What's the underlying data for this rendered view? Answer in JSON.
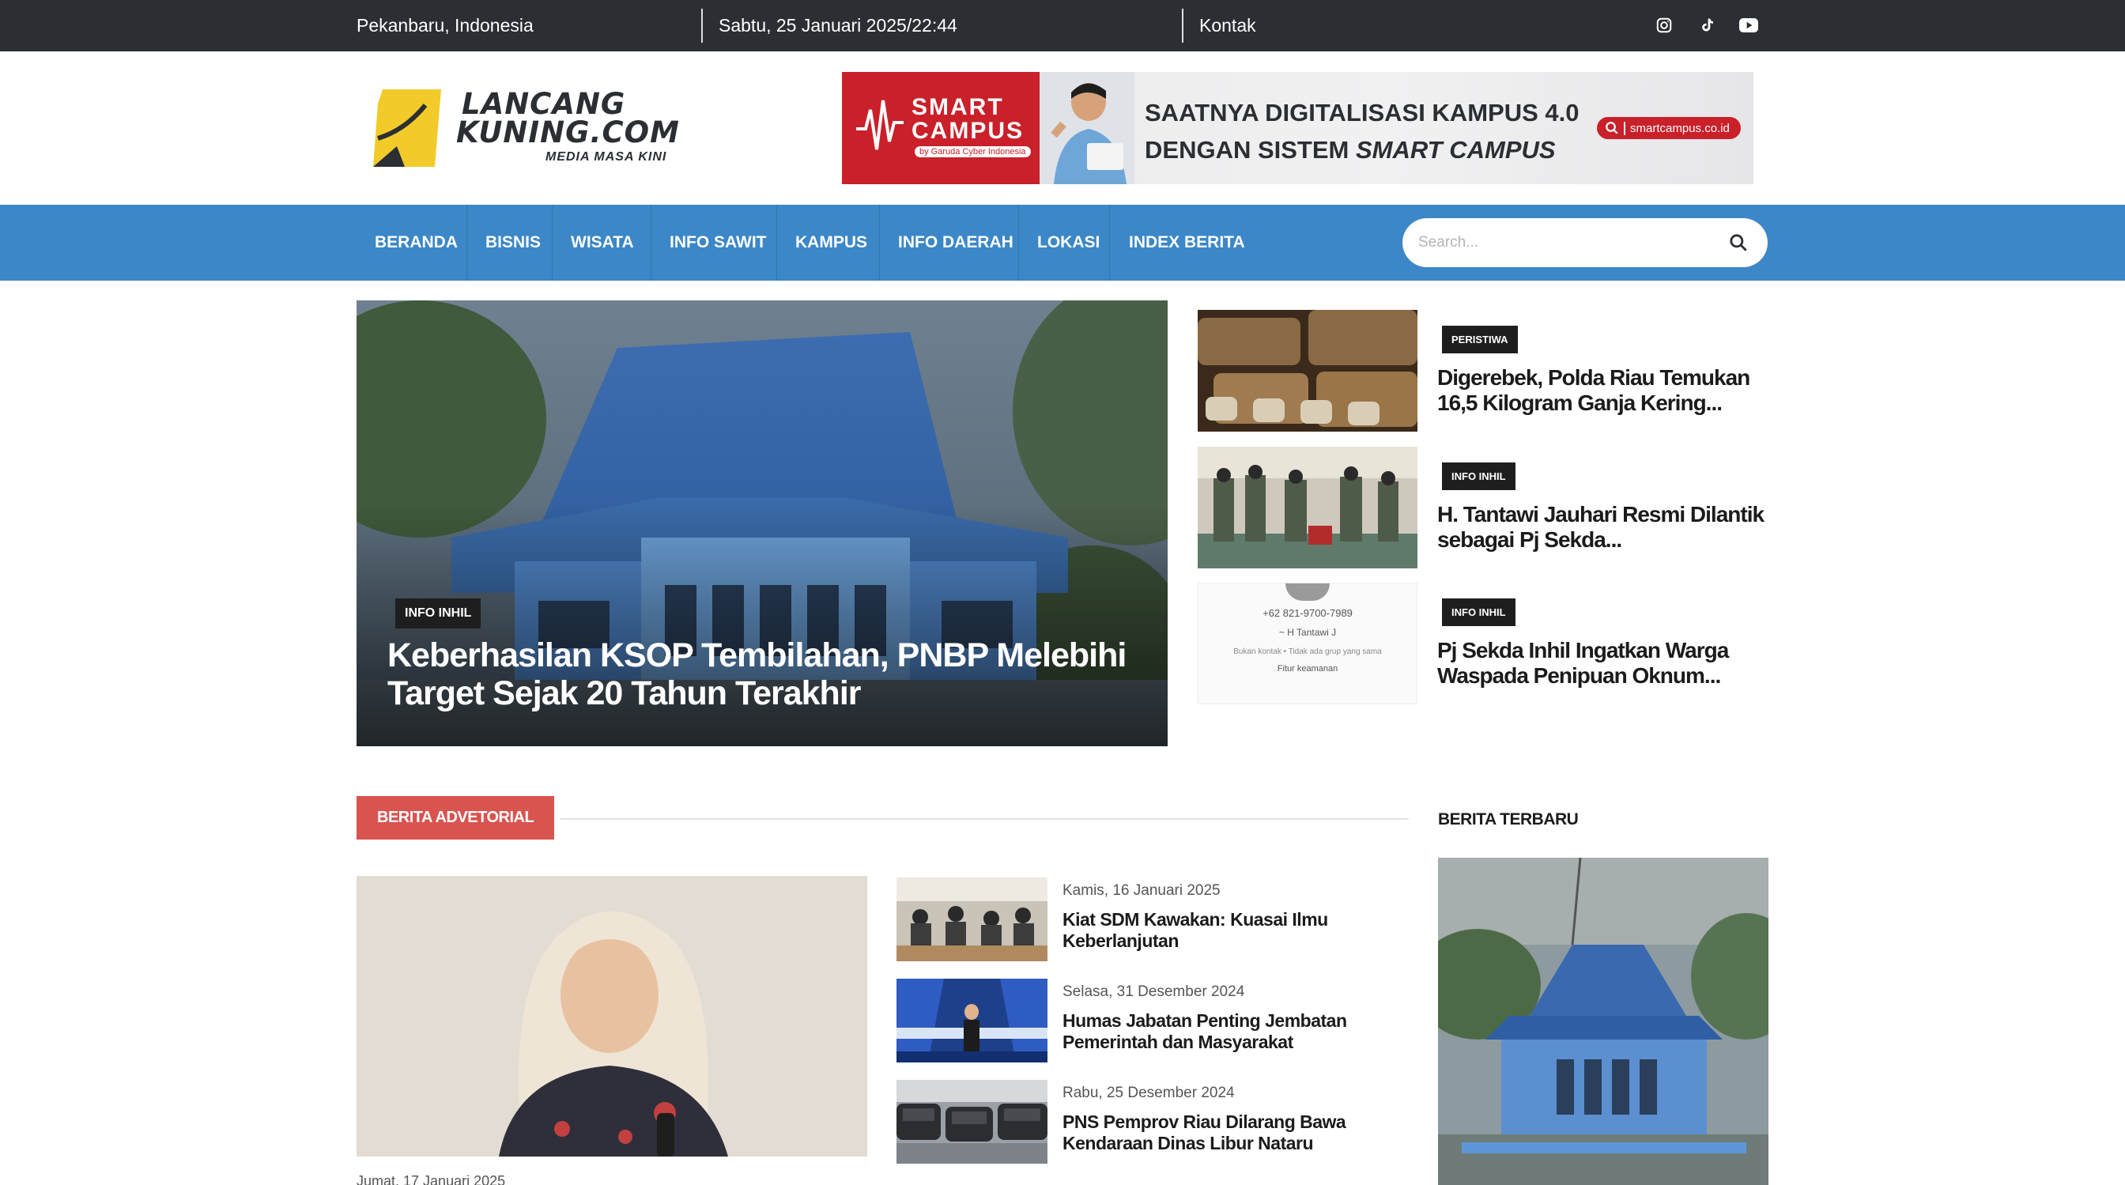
{
  "topbar": {
    "location": "Pekanbaru, Indonesia",
    "datetime": "Sabtu, 25 Januari 2025/22:44",
    "contact": "Kontak",
    "social_icons": [
      "instagram-icon",
      "tiktok-icon",
      "youtube-icon"
    ]
  },
  "logo": {
    "line1": "LANCANG",
    "line2": "KUNING.COM",
    "tagline": "MEDIA MASA KINI"
  },
  "banner": {
    "brand_line1": "SMART",
    "brand_line2": "CAMPUS",
    "brand_by": "by Garuda Cyber Indonesia",
    "headline_line1": "SAATNYA DIGITALISASI KAMPUS 4.0",
    "headline_line2_prefix": "DENGAN SISTEM ",
    "headline_line2_em": "SMART CAMPUS",
    "url": "smartcampus.co.id"
  },
  "nav": {
    "items": [
      "BERANDA",
      "BISNIS",
      "WISATA",
      "INFO SAWIT",
      "KAMPUS",
      "INFO DAERAH",
      "LOKASI",
      "INDEX BERITA"
    ],
    "search_placeholder": "Search..."
  },
  "featured": {
    "category": "INFO INHIL",
    "title": "Keberhasilan KSOP Tembilahan, PNBP Melebihi Target Sejak 20 Tahun Terakhir"
  },
  "side_news": [
    {
      "category": "PERISTIWA",
      "title": "Digerebek, Polda Riau Temukan 16,5 Kilogram Ganja Kering..."
    },
    {
      "category": "INFO INHIL",
      "title": "H. Tantawi Jauhari Resmi Dilantik sebagai Pj Sekda..."
    },
    {
      "category": "INFO INHIL",
      "title": "Pj Sekda Inhil Ingatkan Warga Waspada Penipuan Oknum...",
      "thumb_text": [
        "+62 821-9700-7989",
        "~ H Tantawi J",
        "Bukan kontak • Tidak ada grup yang sama",
        "Fitur keamanan"
      ]
    }
  ],
  "advertorial": {
    "heading": "BERITA ADVETORIAL",
    "main_date": "Jumat, 17 Januari 2025",
    "items": [
      {
        "date": "Kamis, 16 Januari 2025",
        "title": "Kiat SDM Kawakan: Kuasai Ilmu Keberlanjutan"
      },
      {
        "date": "Selasa, 31 Desember 2024",
        "title": "Humas Jabatan Penting Jembatan Pemerintah dan Masyarakat"
      },
      {
        "date": "Rabu, 25 Desember 2024",
        "title": "PNS Pemprov Riau Dilarang Bawa Kendaraan Dinas Libur Nataru"
      }
    ]
  },
  "latest": {
    "heading": "BERITA TERBARU"
  },
  "colors": {
    "topbar": "#2b2e33",
    "nav": "#3b87c8",
    "badge": "#1e1e1e",
    "adv_heading": "#d9534f",
    "logo_yellow": "#f2cb2a"
  }
}
